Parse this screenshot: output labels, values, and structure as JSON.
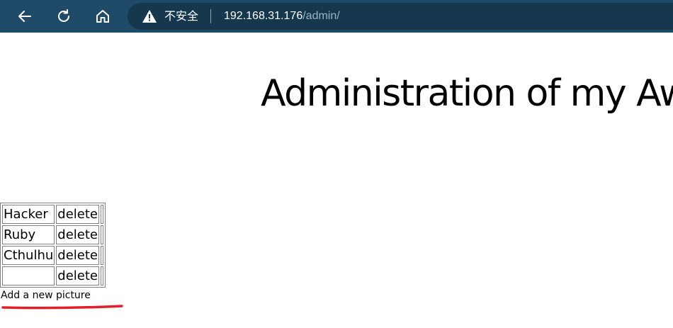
{
  "browser": {
    "security_label": "不安全",
    "url_host": "192.168.31.176",
    "url_path": "/admin/",
    "colors": {
      "toolbar": "#1f4a68",
      "omnibox": "#15384f"
    },
    "icons": [
      "back-arrow-icon",
      "reload-icon",
      "home-icon",
      "warning-icon"
    ]
  },
  "page": {
    "title": "Administration of my Awesome Photos",
    "pictures": [
      {
        "name": "Hacker",
        "action": "delete"
      },
      {
        "name": "Ruby",
        "action": "delete"
      },
      {
        "name": "Cthulhu",
        "action": "delete"
      },
      {
        "name": "",
        "action": "delete"
      }
    ],
    "add_link": "Add a new picture",
    "annotation_color": "#e0202a"
  }
}
